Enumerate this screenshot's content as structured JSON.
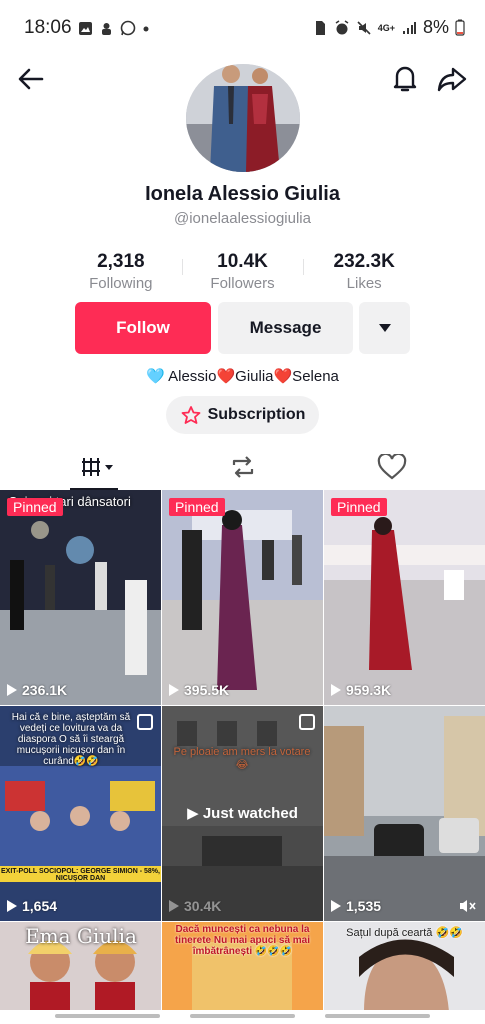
{
  "status_bar": {
    "time": "18:06",
    "battery": "8%",
    "network": "4G+"
  },
  "profile": {
    "display_name": "Ionela Alessio Giulia",
    "username": "@ionelaalessiogiulia",
    "stats": [
      {
        "value": "2,318",
        "label": "Following"
      },
      {
        "value": "10.4K",
        "label": "Followers"
      },
      {
        "value": "232.3K",
        "label": "Likes"
      }
    ],
    "follow_label": "Follow",
    "message_label": "Message",
    "bio": "🩵 Alessio❤️Giulia❤️Selena",
    "subscription_label": "Subscription"
  },
  "videos": [
    {
      "pinned": "Pinned",
      "views": "236.1K",
      "caption": "Cei mai tari dânsatori"
    },
    {
      "pinned": "Pinned",
      "views": "395.5K",
      "caption": ""
    },
    {
      "pinned": "Pinned",
      "views": "959.3K",
      "caption": ""
    },
    {
      "views": "1,654",
      "caption": "Hai că e bine, așteptăm să vedeți ce lovitura va da diaspora O să îi steargă mucușorii nicușor dan în curând🤣🤣",
      "ticker": "EXIT-POLL SOCIOPOL: GEORGE SIMION - 58%, NICUȘOR DAN"
    },
    {
      "views": "30.4K",
      "caption": "Pe ploaie am mers la votare😂",
      "just_watched": "Just watched"
    },
    {
      "views": "1,535",
      "caption": ""
    },
    {
      "views": "",
      "caption": "Ema Giulia"
    },
    {
      "views": "",
      "caption": "Dacă muncești ca nebuna la tinerete Nu mai apuci să mai îmbătrânești 🤣🤣🤣"
    },
    {
      "views": "",
      "caption": "Sațul după ceartă 🤣🤣"
    }
  ],
  "colors": {
    "accent": "#fe2c55",
    "secondary_bg": "#f1f1f2",
    "muted_text": "#8a8b91"
  }
}
